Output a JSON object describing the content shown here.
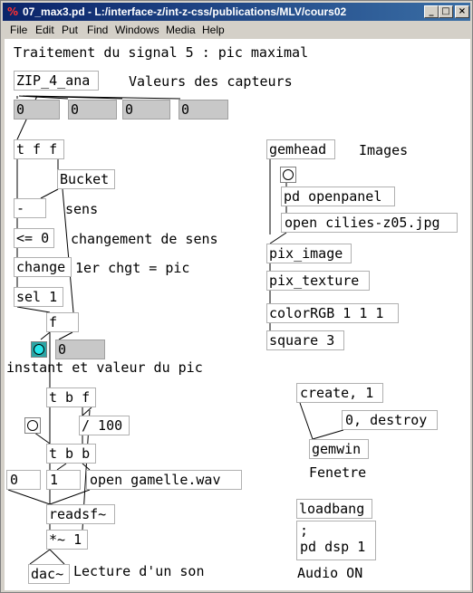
{
  "window": {
    "title": "07_max3.pd - L:/interface-z/int-z-css/publications/MLV/cours02",
    "app_icon": "pd-icon"
  },
  "window_buttons": {
    "minimize": "_",
    "maximize": "□",
    "close": "×"
  },
  "menu": [
    "File",
    "Edit",
    "Put",
    "Find",
    "Windows",
    "Media",
    "Help"
  ],
  "comments": {
    "heading": "Traitement du signal 5 : pic maximal",
    "capteurs": "Valeurs des capteurs",
    "images": "Images",
    "sens": "sens",
    "changement": "changement de sens",
    "premier": "1er chgt = pic",
    "instant": "instant et valeur du pic",
    "fenetre": "Fenetre",
    "lecture": "Lecture d'un son",
    "audio": "Audio ON"
  },
  "objects": {
    "zip": "ZIP_4_ana",
    "tff": "t f f",
    "bucket": "Bucket",
    "minus": "-",
    "le": "<= 0",
    "change": "change",
    "sel": "sel 1",
    "f": "f",
    "tbf": "t b f",
    "div": "/ 100",
    "tbb": "t b b",
    "readsf": "readsf~",
    "mul": "*~ 1",
    "dac": "dac~",
    "gemhead": "gemhead",
    "openpanel": "pd openpanel",
    "pix_image": "pix_image",
    "pix_texture": "pix_texture",
    "color": "colorRGB 1 1 1",
    "square": "square 3",
    "gemwin": "gemwin",
    "loadbang": "loadbang"
  },
  "messages": {
    "open_img": "open cilies-z05.jpg",
    "create": "create, 1",
    "destroy": "0, destroy",
    "zero": "0",
    "one": "1",
    "open_wav": "open gamelle.wav",
    "dsp_line1": ";",
    "dsp_line2": "pd dsp 1"
  },
  "numbers": {
    "cap1": "0",
    "cap2": "0",
    "cap3": "0",
    "cap4": "0",
    "peak": "0"
  }
}
